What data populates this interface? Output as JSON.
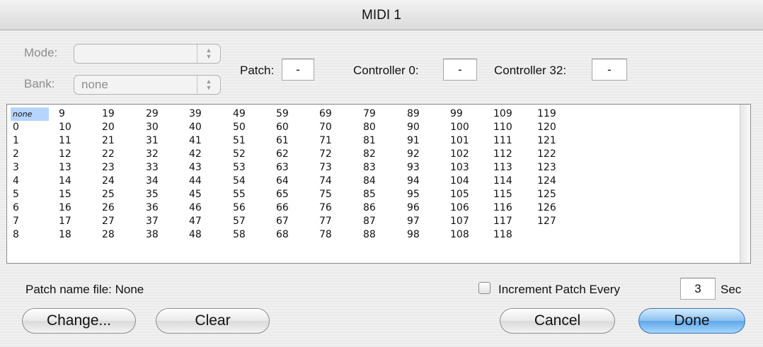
{
  "window": {
    "title": "MIDI 1"
  },
  "settings": {
    "mode_label": "Mode:",
    "mode_value": "",
    "bank_label": "Bank:",
    "bank_value": "none",
    "patch_label": "Patch:",
    "patch_value": "-",
    "controller0_label": "Controller 0:",
    "controller0_value": "-",
    "controller32_label": "Controller 32:",
    "controller32_value": "-"
  },
  "patch_list": {
    "selected": "none",
    "columns": [
      [
        "none",
        "0",
        "1",
        "2",
        "3",
        "4",
        "5",
        "6",
        "7",
        "8"
      ],
      [
        "9",
        "10",
        "11",
        "12",
        "13",
        "14",
        "15",
        "16",
        "17",
        "18"
      ],
      [
        "19",
        "20",
        "21",
        "22",
        "23",
        "24",
        "25",
        "26",
        "27",
        "28"
      ],
      [
        "29",
        "30",
        "31",
        "32",
        "33",
        "34",
        "35",
        "36",
        "37",
        "38"
      ],
      [
        "39",
        "40",
        "41",
        "42",
        "43",
        "44",
        "45",
        "46",
        "47",
        "48"
      ],
      [
        "49",
        "50",
        "51",
        "52",
        "53",
        "54",
        "55",
        "56",
        "57",
        "58"
      ],
      [
        "59",
        "60",
        "61",
        "62",
        "63",
        "64",
        "65",
        "66",
        "67",
        "68"
      ],
      [
        "69",
        "70",
        "71",
        "72",
        "73",
        "74",
        "75",
        "76",
        "77",
        "78"
      ],
      [
        "79",
        "80",
        "81",
        "82",
        "83",
        "84",
        "85",
        "86",
        "87",
        "88"
      ],
      [
        "89",
        "90",
        "91",
        "92",
        "93",
        "94",
        "95",
        "96",
        "97",
        "98"
      ],
      [
        "99",
        "100",
        "101",
        "102",
        "103",
        "104",
        "105",
        "106",
        "107",
        "108"
      ],
      [
        "109",
        "110",
        "111",
        "112",
        "113",
        "114",
        "115",
        "116",
        "117",
        "118"
      ],
      [
        "119",
        "120",
        "121",
        "122",
        "123",
        "124",
        "125",
        "126",
        "127"
      ]
    ]
  },
  "footer": {
    "patch_name_file_label": "Patch name file: None",
    "increment_label": "Increment Patch Every",
    "increment_checked": false,
    "increment_value": "3",
    "increment_unit": "Sec",
    "change_button": "Change...",
    "clear_button": "Clear",
    "cancel_button": "Cancel",
    "done_button": "Done"
  }
}
